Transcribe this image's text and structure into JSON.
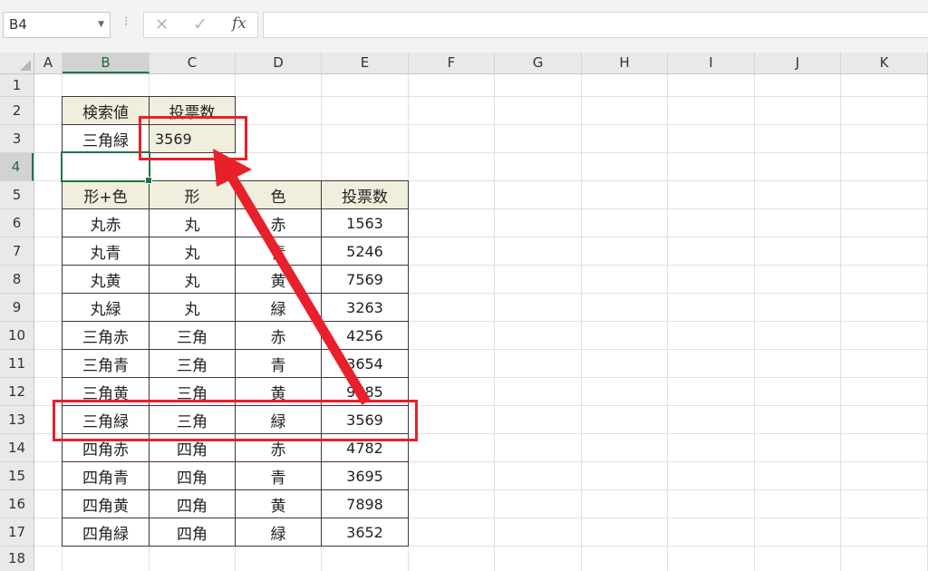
{
  "name_box": "B4",
  "formula_bar": {
    "cancel_icon": "✕",
    "enter_icon": "✓",
    "fx_label": "fx",
    "formula": ""
  },
  "columns": [
    "A",
    "B",
    "C",
    "D",
    "E",
    "F",
    "G",
    "H",
    "I",
    "J",
    "K"
  ],
  "rows": [
    "1",
    "2",
    "3",
    "4",
    "5",
    "6",
    "7",
    "8",
    "9",
    "10",
    "11",
    "12",
    "13",
    "14",
    "15",
    "16",
    "17",
    "18"
  ],
  "active_cell": "B4",
  "lookup": {
    "header": [
      "検索値",
      "投票数"
    ],
    "values": [
      "三角緑",
      "3569"
    ]
  },
  "table": {
    "headers": [
      "形+色",
      "形",
      "色",
      "投票数"
    ],
    "rows": [
      [
        "丸赤",
        "丸",
        "赤",
        "1563"
      ],
      [
        "丸青",
        "丸",
        "青",
        "5246"
      ],
      [
        "丸黄",
        "丸",
        "黄",
        "7569"
      ],
      [
        "丸緑",
        "丸",
        "緑",
        "3263"
      ],
      [
        "三角赤",
        "三角",
        "赤",
        "4256"
      ],
      [
        "三角青",
        "三角",
        "青",
        "3654"
      ],
      [
        "三角黄",
        "三角",
        "黄",
        "9685"
      ],
      [
        "三角緑",
        "三角",
        "緑",
        "3569"
      ],
      [
        "四角赤",
        "四角",
        "赤",
        "4782"
      ],
      [
        "四角青",
        "四角",
        "青",
        "3695"
      ],
      [
        "四角黄",
        "四角",
        "黄",
        "7898"
      ],
      [
        "四角緑",
        "四角",
        "緑",
        "3652"
      ]
    ]
  },
  "colors": {
    "highlight": "#e8202a",
    "selection": "#217346",
    "header_fill": "#f0efde"
  }
}
